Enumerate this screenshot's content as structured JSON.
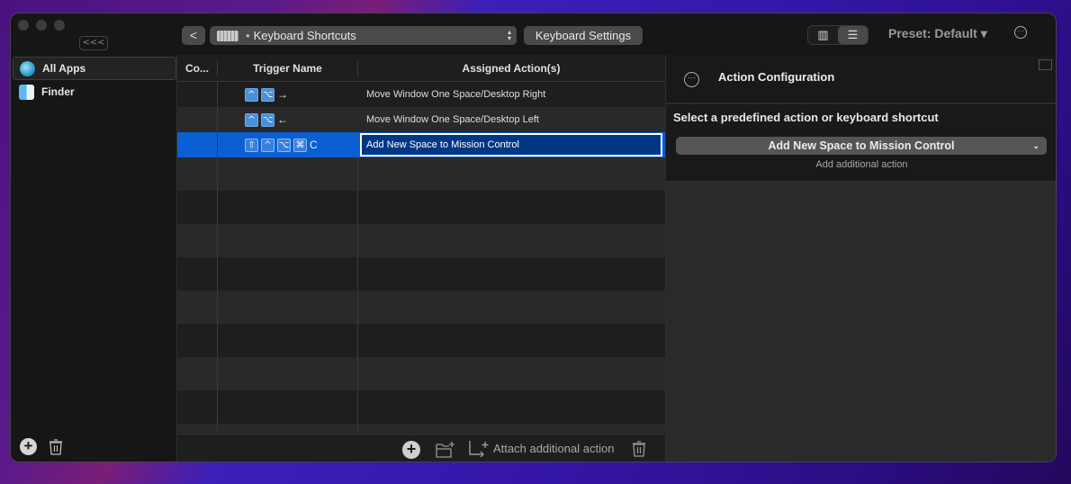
{
  "window": {
    "collapse_label": "<<<",
    "back_label": "<",
    "breadcrumb": {
      "dot": "•",
      "label": "Keyboard Shortcuts"
    },
    "keyboard_settings_label": "Keyboard Settings",
    "view_modes": [
      {
        "icon": "columns-icon",
        "glyph": "▥",
        "active": false
      },
      {
        "icon": "list-icon",
        "glyph": "☰",
        "active": true
      }
    ],
    "preset_label": "Preset: Default ▾",
    "more_glyph": "···"
  },
  "sidebar": {
    "items": [
      {
        "label": "All Apps",
        "icon": "globe-icon",
        "selected": true
      },
      {
        "label": "Finder",
        "icon": "finder-icon",
        "selected": false
      }
    ],
    "add_glyph": "+"
  },
  "table": {
    "columns": [
      "Co...",
      "Trigger Name",
      "Assigned Action(s)"
    ],
    "rows": [
      {
        "keys": [
          "^",
          "⌥"
        ],
        "suffix": "→",
        "action": "Move Window One Space/Desktop Right",
        "selected": false
      },
      {
        "keys": [
          "^",
          "⌥"
        ],
        "suffix": "←",
        "action": "Move Window One Space/Desktop Left",
        "selected": false
      },
      {
        "keys": [
          "⇧",
          "^",
          "⌥",
          "⌘"
        ],
        "suffix": "C",
        "action": "Add New Space to Mission Control",
        "selected": true
      }
    ],
    "empty_rows": 8,
    "footer": {
      "add_glyph": "+",
      "attach_label": "Attach additional action"
    }
  },
  "panel": {
    "title": "Action Configuration",
    "more_glyph": "···",
    "select_label": "Select a predefined action or keyboard shortcut",
    "selected_action": "Add New Space to Mission Control",
    "chevron": "⌄",
    "add_additional_label": "Add additional action"
  },
  "colors": {
    "selection": "#0a5fd4",
    "edit_field": "#003785",
    "key_bg": "#4a90d8"
  }
}
